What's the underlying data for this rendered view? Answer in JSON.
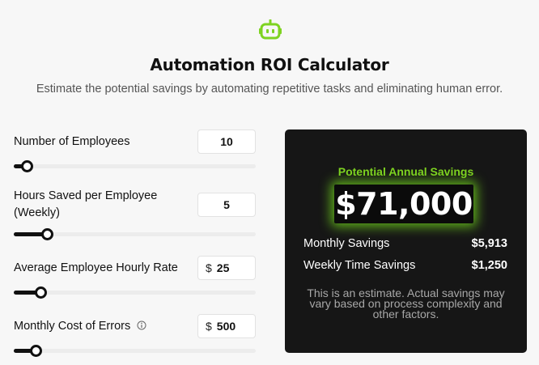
{
  "header": {
    "logo_icon": "robot-icon",
    "accent_color": "#7ed321",
    "title": "Automation ROI Calculator",
    "subtitle": "Estimate the potential savings by automating repetitive tasks and eliminating human error."
  },
  "inputs": {
    "employees": {
      "label": "Number of Employees",
      "value": "10",
      "slider_fraction": 0.03
    },
    "hours": {
      "label": "Hours Saved per Employee (Weekly)",
      "value": "5",
      "slider_fraction": 0.12
    },
    "rate": {
      "label": "Average Employee Hourly Rate",
      "prefix": "$",
      "value": "25",
      "slider_fraction": 0.09
    },
    "errors": {
      "label": "Monthly Cost of Errors",
      "info_icon": "info-icon",
      "prefix": "$",
      "value": "500",
      "slider_fraction": 0.07
    }
  },
  "results": {
    "heading": "Potential Annual Savings",
    "annual_savings": "$71,000",
    "monthly_label": "Monthly Savings",
    "monthly_value": "$5,913",
    "weekly_label": "Weekly Time Savings",
    "weekly_value": "$1,250",
    "disclaimer": "This is an estimate. Actual savings may vary based on process complexity and other factors."
  }
}
